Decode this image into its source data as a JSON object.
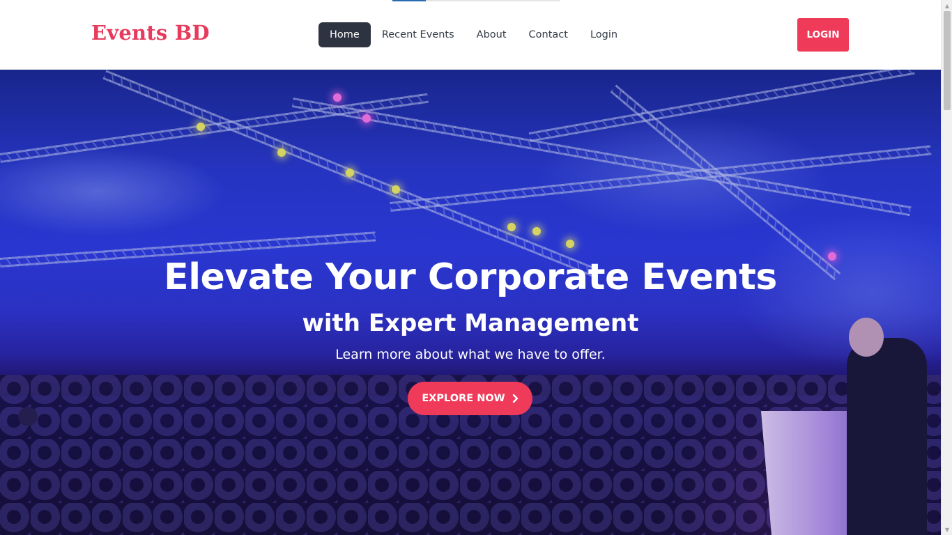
{
  "header": {
    "brand": "Events BD",
    "nav": [
      {
        "label": "Home",
        "active": true
      },
      {
        "label": "Recent Events",
        "active": false
      },
      {
        "label": "About",
        "active": false
      },
      {
        "label": "Contact",
        "active": false
      },
      {
        "label": "Login",
        "active": false
      }
    ],
    "login_button": "LOGIN"
  },
  "hero": {
    "title": "Elevate Your Corporate Events",
    "subtitle": "with Expert Management",
    "tagline": "Learn more about what we have to offer.",
    "cta_label": "EXPLORE NOW",
    "cta_icon": "chevron-right-icon"
  },
  "colors": {
    "brand": "#e63b5c",
    "accent": "#f03a5a",
    "nav_active_bg": "#2d3340"
  }
}
